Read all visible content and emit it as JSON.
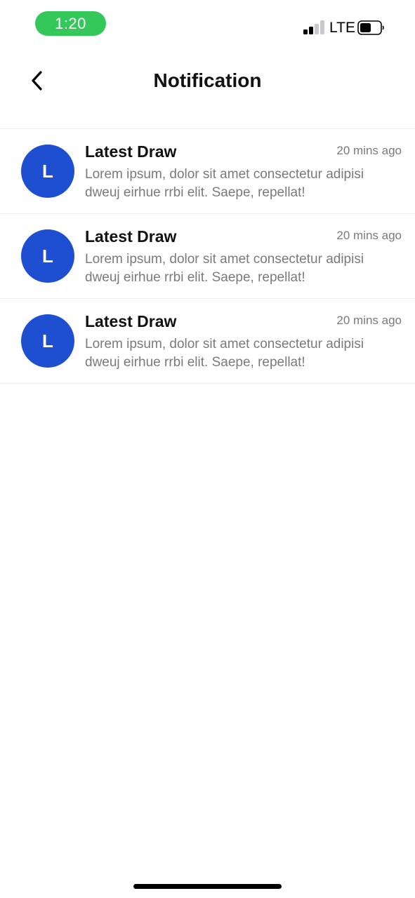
{
  "status_bar": {
    "time": "1:20",
    "network": "LTE",
    "time_pill_color": "#34c759"
  },
  "header": {
    "title": "Notification",
    "back_icon": "chevron-left-icon"
  },
  "notifications": [
    {
      "avatar_letter": "L",
      "title": "Latest Draw",
      "time": "20 mins ago",
      "body": "Lorem ipsum, dolor sit amet consectetur adipisi dweuj eirhue rrbi elit. Saepe, repellat!"
    },
    {
      "avatar_letter": "L",
      "title": "Latest Draw",
      "time": "20 mins ago",
      "body": "Lorem ipsum, dolor sit amet consectetur adipisi dweuj eirhue rrbi elit. Saepe, repellat!"
    },
    {
      "avatar_letter": "L",
      "title": "Latest Draw",
      "time": "20 mins ago",
      "body": "Lorem ipsum, dolor sit amet consectetur adipisi dweuj eirhue rrbi elit. Saepe, repellat!"
    }
  ],
  "colors": {
    "avatar": "#1f4fd1",
    "secondary_text": "#7a7a7a"
  }
}
